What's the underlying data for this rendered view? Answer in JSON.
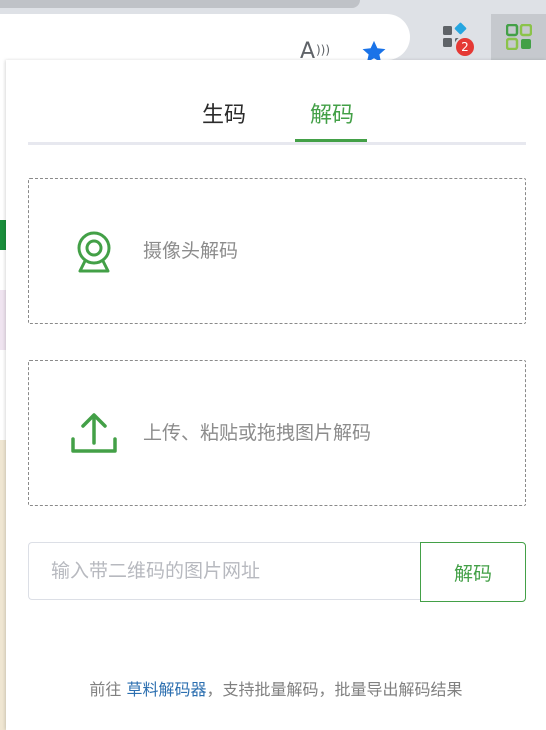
{
  "toolbar": {
    "read_aloud_icon": "read-aloud-icon",
    "favorite_icon": "star-icon",
    "extensions_badge": "2",
    "extension_icon": "qr-extension-icon",
    "accent": "#1a73e8"
  },
  "tabs": [
    {
      "label": "生码",
      "active": false
    },
    {
      "label": "解码",
      "active": true
    }
  ],
  "camera": {
    "icon": "webcam-icon",
    "label": "摄像头解码"
  },
  "upload": {
    "icon": "upload-icon",
    "label": "上传、粘贴或拖拽图片解码"
  },
  "url_input": {
    "placeholder": "输入带二维码的图片网址",
    "value": ""
  },
  "decode_button": "解码",
  "footer": {
    "prefix": "前往",
    "link": "草料解码器",
    "suffix": "，支持批量解码，批量导出解码结果"
  },
  "colors": {
    "accent": "#43a047",
    "link": "#2c6fb0",
    "badge": "#e53935"
  }
}
